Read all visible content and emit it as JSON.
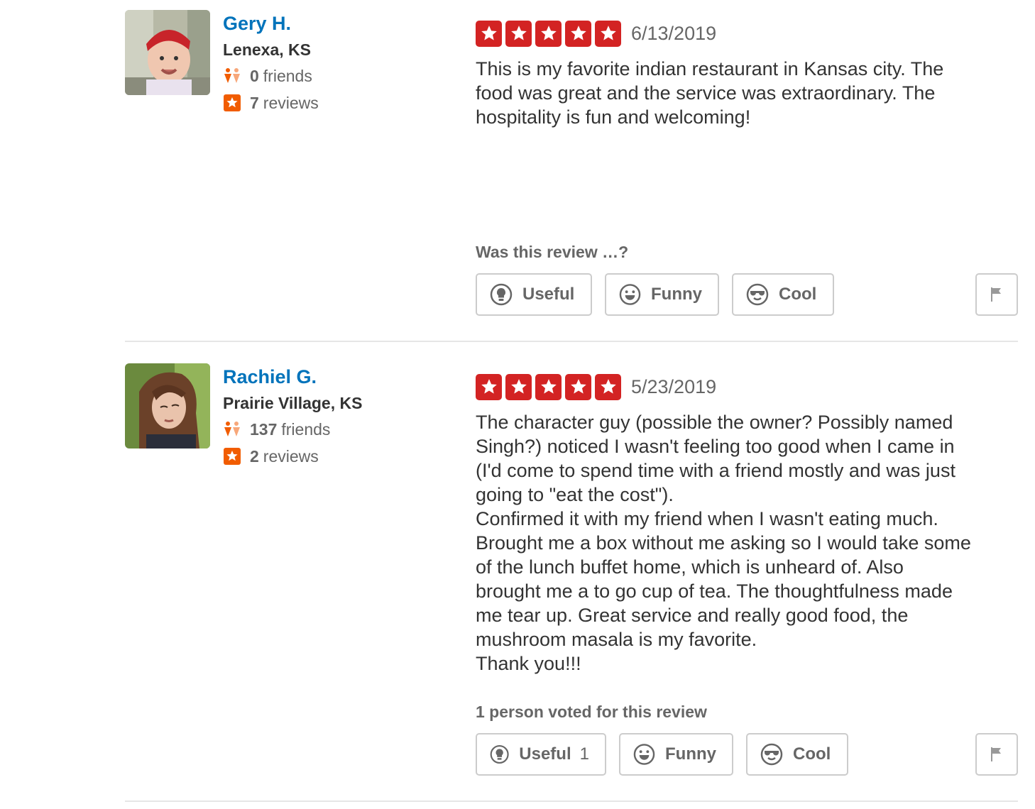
{
  "reviews": [
    {
      "user": {
        "name": "Gery H.",
        "location": "Lenexa, KS",
        "friends_count": "0",
        "friends_label": "friends",
        "reviews_count": "7",
        "reviews_label": "reviews",
        "avatar_icon": "user-photo-baby"
      },
      "rating": 5,
      "date": "6/13/2019",
      "text": "This is my favorite indian restaurant in Kansas city. The\nfood was great and the service was extraordinary.  The\nhospitality is fun and welcoming!",
      "vote_heading": "Was this review …?",
      "buttons": {
        "useful": {
          "label": "Useful",
          "count": ""
        },
        "funny": {
          "label": "Funny",
          "count": ""
        },
        "cool": {
          "label": "Cool",
          "count": ""
        }
      }
    },
    {
      "user": {
        "name": "Rachiel G.",
        "location": "Prairie Village, KS",
        "friends_count": "137",
        "friends_label": "friends",
        "reviews_count": "2",
        "reviews_label": "reviews",
        "avatar_icon": "user-photo-woman"
      },
      "rating": 5,
      "date": "5/23/2019",
      "text": "The character guy (possible the owner? Possibly named\nSingh?) noticed I wasn't feeling too good when I came in\n(I'd come to spend time with a friend mostly and was just\ngoing to \"eat the cost\").\nConfirmed it with my friend when I wasn't eating much.\nBrought me a box without me asking so I would take some\nof the lunch buffet home, which is unheard of. Also\nbrought me a to go cup of tea. The thoughtfulness made\nme tear up. Great service and really good food, the\nmushroom masala is my favorite.\nThank you!!!",
      "vote_heading": "1 person voted for this review",
      "buttons": {
        "useful": {
          "label": "Useful",
          "count": "1"
        },
        "funny": {
          "label": "Funny",
          "count": ""
        },
        "cool": {
          "label": "Cool",
          "count": ""
        }
      }
    }
  ],
  "colors": {
    "star_red": "#d32323",
    "link_blue": "#0073bb",
    "stat_orange": "#f15c00"
  }
}
